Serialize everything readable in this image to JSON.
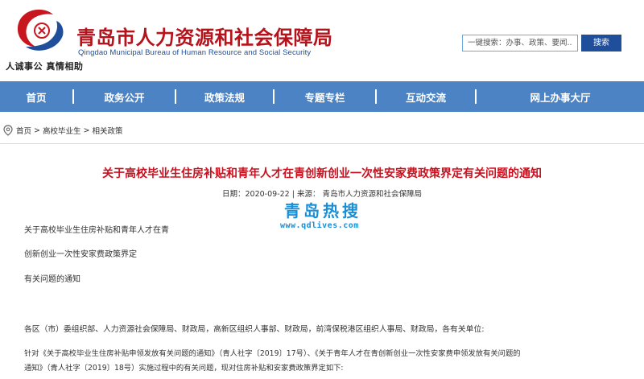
{
  "header": {
    "site_title": "青岛市人力资源和社会保障局",
    "site_subtitle": "Qingdao Municipal Bureau of Human Resource and Social Security",
    "slogan": "人诚事公 真情相助",
    "search_placeholder": "一键搜索：办事、政策、要闻...",
    "search_button": "搜索",
    "brand_color": "#b5121b",
    "accent_color": "#1f4e9b"
  },
  "nav": {
    "background": "#4b83c4",
    "items": [
      {
        "label": "首页"
      },
      {
        "label": "政务公开"
      },
      {
        "label": "政策法规"
      },
      {
        "label": "专题专栏"
      },
      {
        "label": "互动交流"
      },
      {
        "label": "网上办事大厅"
      }
    ]
  },
  "breadcrumb": {
    "icon": "location-pin-icon",
    "items": [
      "首页",
      "高校毕业生",
      "相关政策"
    ],
    "separator": ">"
  },
  "article": {
    "title": "关于高校毕业生住房补贴和青年人才在青创新创业一次性安家费政策界定有关问题的通知",
    "meta": "日期：2020-09-22 | 来源： 青岛市人力资源和社会保障局",
    "watermark_cn": "青岛热搜",
    "watermark_url": "www.qdlives.com",
    "heading_lines": [
      "关于高校毕业生住房补贴和青年人才在青",
      "创新创业一次性安家费政策界定",
      "有关问题的通知"
    ],
    "recipients": "各区（市）委组织部、人力资源社会保障局、财政局，高新区组织人事部、财政局，前湾保税港区组织人事局、财政局，各有关单位:",
    "body_line1": "针对《关于高校毕业生住房补贴申领发放有关问题的通知》（青人社字〔2019〕17号）、《关于青年人才在青创新创业一次性安家费申领发放有关问题的",
    "body_line2": "通知》（青人社字〔2019〕18号）实施过程中的有关问题，现对住房补贴和安家费政策界定如下:"
  }
}
